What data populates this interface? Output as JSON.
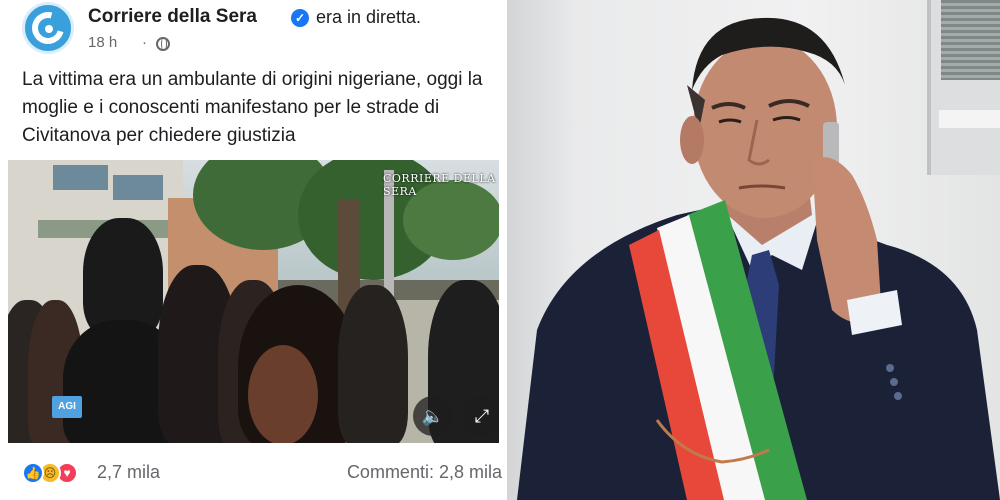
{
  "post": {
    "page_name": "Corriere della Sera",
    "status": "era in diretta.",
    "time": "18 h",
    "separator": "·",
    "text": "La vittima era un ambulante di origini nigeriane, oggi la moglie e i conoscenti manifestano per le strade di Civitanova per chiedere giustizia",
    "video": {
      "watermark": "CORRIERE DELLA SERA",
      "badge": "AGI"
    },
    "reactions": {
      "count": "2,7 mila",
      "comments": "Commenti: 2,8 mila",
      "icons": [
        "like-icon",
        "sad-icon",
        "love-icon"
      ]
    },
    "colors": {
      "brand": "#3aa0dc",
      "verified": "#1877f2",
      "meta_text": "#65676b"
    }
  },
  "photo": {
    "sash_colors": [
      "#e8483a",
      "#ffffff",
      "#3ba04a"
    ],
    "suit_color": "#1b2238"
  }
}
